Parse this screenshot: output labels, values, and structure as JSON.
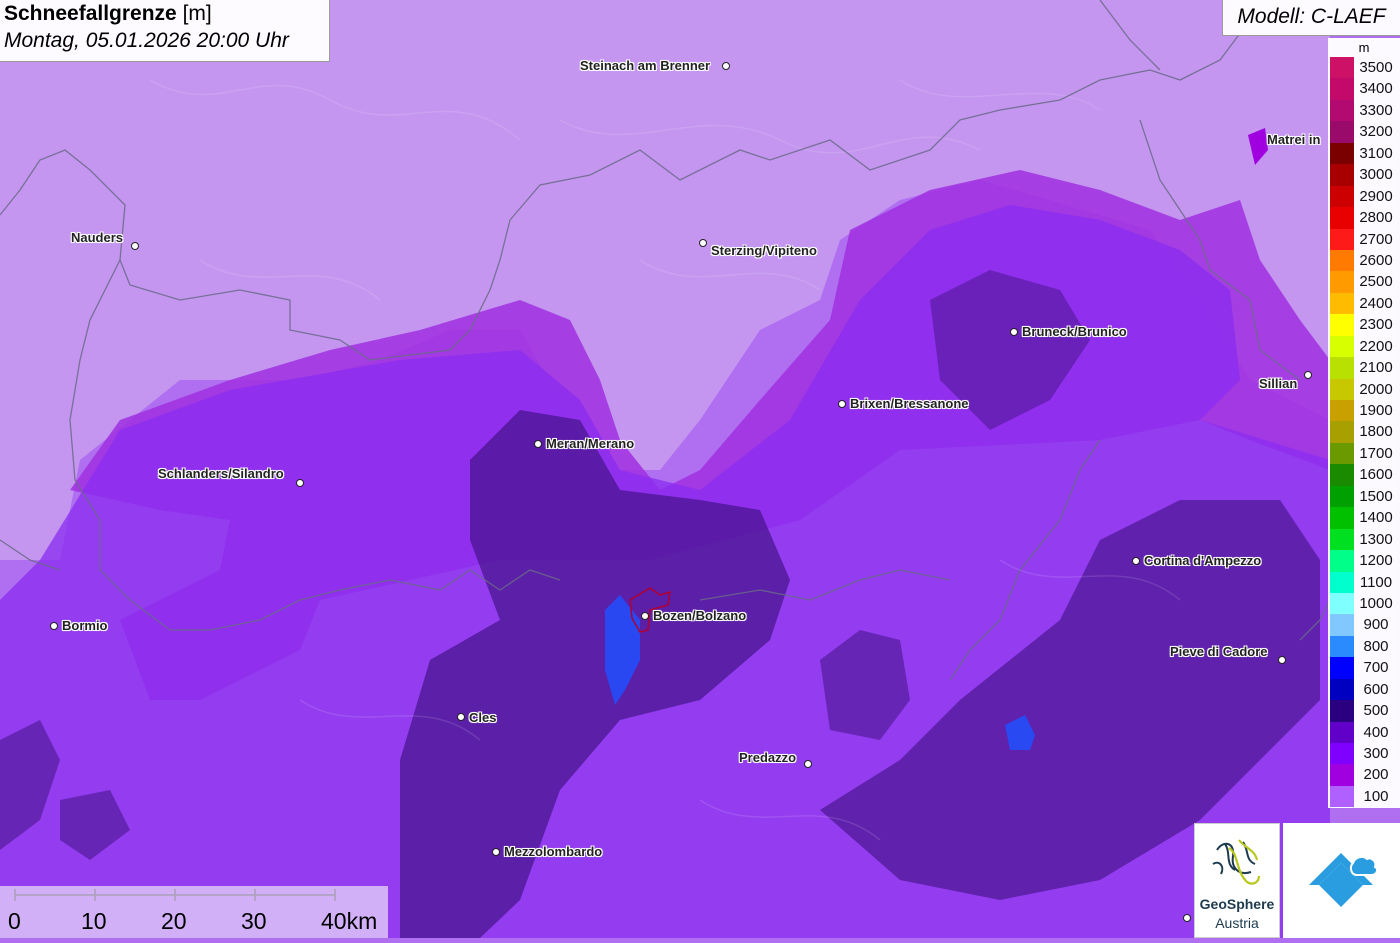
{
  "title": {
    "main": "Schneefallgrenze",
    "unit": "[m]",
    "datetime": "Montag, 05.01.2026 20:00 Uhr"
  },
  "model": "Modell: C-LAEF",
  "legend": {
    "unit": "m",
    "entries": [
      {
        "label": "3500",
        "color": "#cc1166"
      },
      {
        "label": "3400",
        "color": "#c30a6a"
      },
      {
        "label": "3300",
        "color": "#b20a70"
      },
      {
        "label": "3200",
        "color": "#9a0a6a"
      },
      {
        "label": "3100",
        "color": "#7a0000"
      },
      {
        "label": "3000",
        "color": "#a80000"
      },
      {
        "label": "2900",
        "color": "#cc0000"
      },
      {
        "label": "2800",
        "color": "#e80000"
      },
      {
        "label": "2700",
        "color": "#ff1a1a"
      },
      {
        "label": "2600",
        "color": "#ff7a00"
      },
      {
        "label": "2500",
        "color": "#ff9a00"
      },
      {
        "label": "2400",
        "color": "#ffbb00"
      },
      {
        "label": "2300",
        "color": "#ffff00"
      },
      {
        "label": "2200",
        "color": "#d8ff00"
      },
      {
        "label": "2100",
        "color": "#b8e000"
      },
      {
        "label": "2000",
        "color": "#c8c800"
      },
      {
        "label": "1900",
        "color": "#c8a000"
      },
      {
        "label": "1800",
        "color": "#a8a000"
      },
      {
        "label": "1700",
        "color": "#6a9a00"
      },
      {
        "label": "1600",
        "color": "#1a8a00"
      },
      {
        "label": "1500",
        "color": "#00a000"
      },
      {
        "label": "1400",
        "color": "#00c000"
      },
      {
        "label": "1300",
        "color": "#00e020"
      },
      {
        "label": "1200",
        "color": "#00ff88"
      },
      {
        "label": "1100",
        "color": "#00ffcc"
      },
      {
        "label": "1000",
        "color": "#80ffff"
      },
      {
        "label": "900",
        "color": "#80c8ff"
      },
      {
        "label": "800",
        "color": "#2a8aff"
      },
      {
        "label": "700",
        "color": "#0000ff"
      },
      {
        "label": "600",
        "color": "#0000c0"
      },
      {
        "label": "500",
        "color": "#2a0080"
      },
      {
        "label": "400",
        "color": "#6000c8"
      },
      {
        "label": "300",
        "color": "#8000ff"
      },
      {
        "label": "200",
        "color": "#a000e0"
      },
      {
        "label": "100",
        "color": "#b060ff"
      }
    ]
  },
  "cities": [
    {
      "name": "Steinach am Brenner"
    },
    {
      "name": "Nauders"
    },
    {
      "name": "Sterzing/Vipiteno"
    },
    {
      "name": "Matrei in"
    },
    {
      "name": "Bruneck/Brunico"
    },
    {
      "name": "Sillian"
    },
    {
      "name": "Brixen/Bressanone"
    },
    {
      "name": "Meran/Merano"
    },
    {
      "name": "Schlanders/Silandro"
    },
    {
      "name": "Cortina d'Ampezzo"
    },
    {
      "name": "Bormio"
    },
    {
      "name": "Bozen/Bolzano"
    },
    {
      "name": "Pieve di Cadore"
    },
    {
      "name": "Cles"
    },
    {
      "name": "Predazzo"
    },
    {
      "name": "Mezzolombardo"
    }
  ],
  "scalebar": {
    "labels": [
      "0",
      "10",
      "20",
      "30",
      "40km"
    ]
  },
  "logos": {
    "geosphere_line1": "GeoSphere",
    "geosphere_line2": "Austria"
  }
}
